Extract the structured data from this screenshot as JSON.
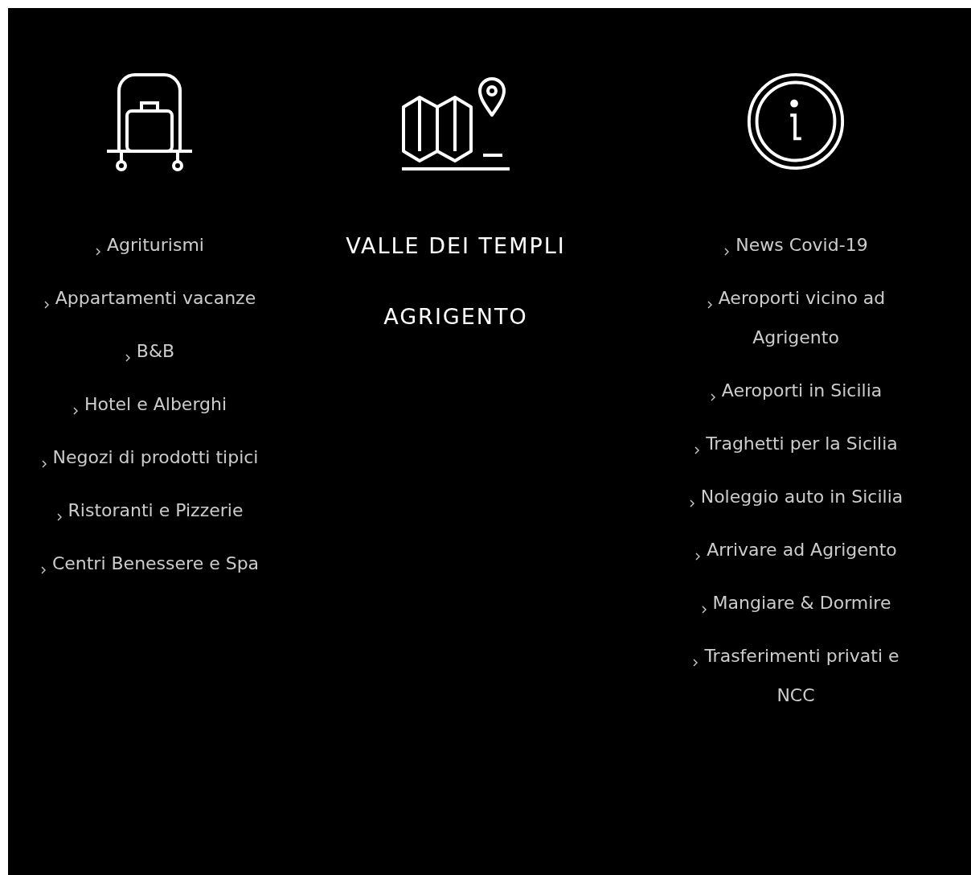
{
  "columns": [
    {
      "links": [
        "Agriturismi",
        "Appartamenti vacanze",
        "B&B",
        "Hotel e Alberghi",
        "Negozi di prodotti tipici",
        "Ristoranti e Pizzerie",
        "Centri Benessere e Spa"
      ]
    },
    {
      "headings": [
        "VALLE DEI TEMPLI",
        "AGRIGENTO"
      ]
    },
    {
      "links": [
        "News Covid-19",
        "Aeroporti vicino ad Agrigento",
        "Aeroporti in Sicilia",
        "Traghetti per la Sicilia",
        "Noleggio auto in Sicilia",
        "Arrivare ad Agrigento",
        "Mangiare & Dormire",
        "Trasferimenti privati e NCC"
      ]
    }
  ]
}
